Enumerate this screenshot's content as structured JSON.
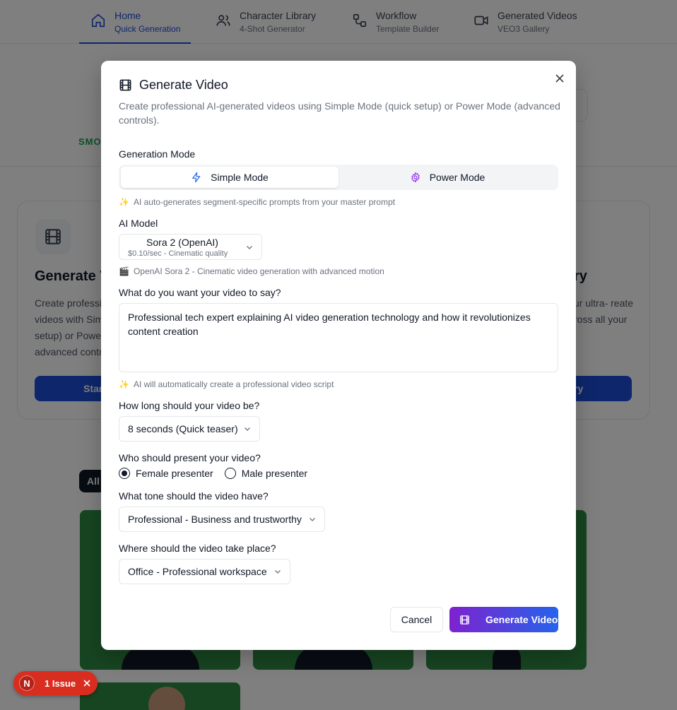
{
  "nav": {
    "items": [
      {
        "title": "Home",
        "subtitle": "Quick Generation",
        "icon": "home-icon",
        "active": true
      },
      {
        "title": "Character Library",
        "subtitle": "4-Shot Generator",
        "icon": "users-icon",
        "active": false
      },
      {
        "title": "Workflow",
        "subtitle": "Template Builder",
        "icon": "workflow-icon",
        "active": false
      },
      {
        "title": "Generated Videos",
        "subtitle": "VEO3 Gallery",
        "icon": "video-icon",
        "active": false
      }
    ]
  },
  "background": {
    "smo_text": "SMO",
    "card_title_left": "Generate V",
    "card_title_right": "ry",
    "card_desc_left": "Create professi videos with Sim setup) or Power advanced contr",
    "card_desc_right": "ur ultra- reate ross all your",
    "btn_left": "Star",
    "btn_right": "ry",
    "filter_all": "All"
  },
  "modal": {
    "title": "Generate Video",
    "description": "Create professional AI-generated videos using Simple Mode (quick setup) or Power Mode (advanced controls).",
    "generation_mode": {
      "label": "Generation Mode",
      "simple": "Simple Mode",
      "power": "Power Mode",
      "selected": "simple",
      "hint": "AI auto-generates segment-specific prompts from your master prompt"
    },
    "ai_model": {
      "label": "AI Model",
      "selected": "Sora 2 (OpenAI)",
      "selected_sub": "$0.10/sec - Cinematic quality",
      "hint": "OpenAI Sora 2 - Cinematic video generation with advanced motion"
    },
    "prompt": {
      "label": "What do you want your video to say?",
      "value": "Professional tech expert explaining AI video generation technology and how it revolutionizes content creation",
      "hint": "AI will automatically create a professional video script"
    },
    "duration": {
      "label": "How long should your video be?",
      "selected": "8 seconds (Quick teaser)"
    },
    "presenter": {
      "label": "Who should present your video?",
      "options": [
        "Female presenter",
        "Male presenter"
      ],
      "selected": "Female presenter"
    },
    "tone": {
      "label": "What tone should the video have?",
      "selected": "Professional - Business and trustworthy"
    },
    "location": {
      "label": "Where should the video take place?",
      "selected": "Office - Professional workspace"
    },
    "buttons": {
      "cancel": "Cancel",
      "generate": "Generate Video"
    }
  },
  "issue_badge": {
    "letter": "N",
    "text": "1 Issue"
  },
  "colors": {
    "accent": "#1d4ed8",
    "gradient_start": "#7e22ce",
    "gradient_end": "#2563eb",
    "issue_red": "#d92d20",
    "thumb_green": "#2f8a42"
  }
}
